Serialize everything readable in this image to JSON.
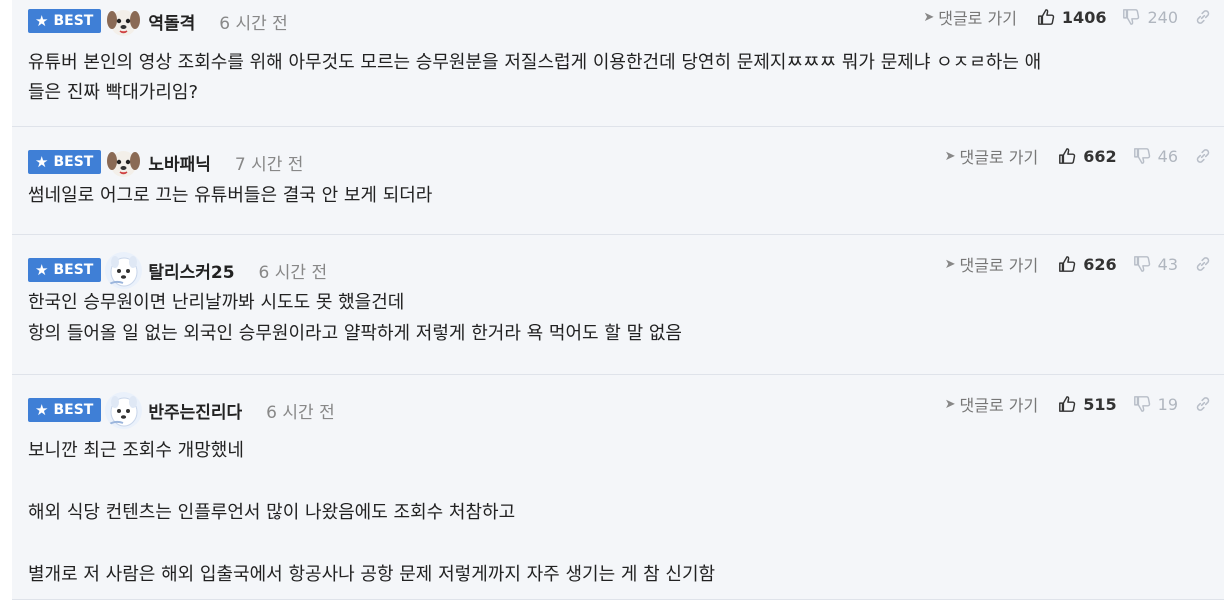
{
  "ui": {
    "best_label": "BEST",
    "goto_label": "댓글로 가기"
  },
  "colors": {
    "best_badge": "#3f7fd6",
    "comment_bg": "#f4f6f9",
    "divider": "#dfe3ea",
    "time_text": "#888888"
  },
  "comments": [
    {
      "nickname": "역돌격",
      "time": "6 시간 전",
      "likes": "1406",
      "dislikes": "240",
      "avatar_icon": "puppy-avatar-icon",
      "lines": [
        "유튜버 본인의 영상 조회수를 위해 아무것도 모르는 승무원분을 저질스럽게 이용한건데 당연히 문제지ㅉㅉㅉ 뭐가 문제냐 ㅇㅈㄹ하는 애",
        "들은 진짜 빡대가리임?"
      ]
    },
    {
      "nickname": "노바패닉",
      "time": "7 시간 전",
      "likes": "662",
      "dislikes": "46",
      "avatar_icon": "puppy-avatar-icon",
      "lines": [
        "썸네일로 어그로 끄는 유튜버들은 결국 안 보게 되더라"
      ]
    },
    {
      "nickname": "탈리스커25",
      "time": "6 시간 전",
      "likes": "626",
      "dislikes": "43",
      "avatar_icon": "white-dog-avatar-icon",
      "lines": [
        "한국인 승무원이면 난리날까봐 시도도 못 했을건데",
        "항의 들어올 일 없는 외국인 승무원이라고 얄팍하게 저렇게 한거라 욕 먹어도 할 말 없음"
      ]
    },
    {
      "nickname": "반주는진리다",
      "time": "6 시간 전",
      "likes": "515",
      "dislikes": "19",
      "avatar_icon": "white-dog-avatar-icon",
      "lines": [
        "보니깐 최근 조회수 개망했네",
        "해외 식당 컨텐츠는 인플루언서 많이 나왔음에도 조회수 처참하고",
        "별개로 저 사람은 해외 입출국에서 항공사나 공항 문제 저렇게까지 자주 생기는 게 참 신기함"
      ]
    }
  ]
}
